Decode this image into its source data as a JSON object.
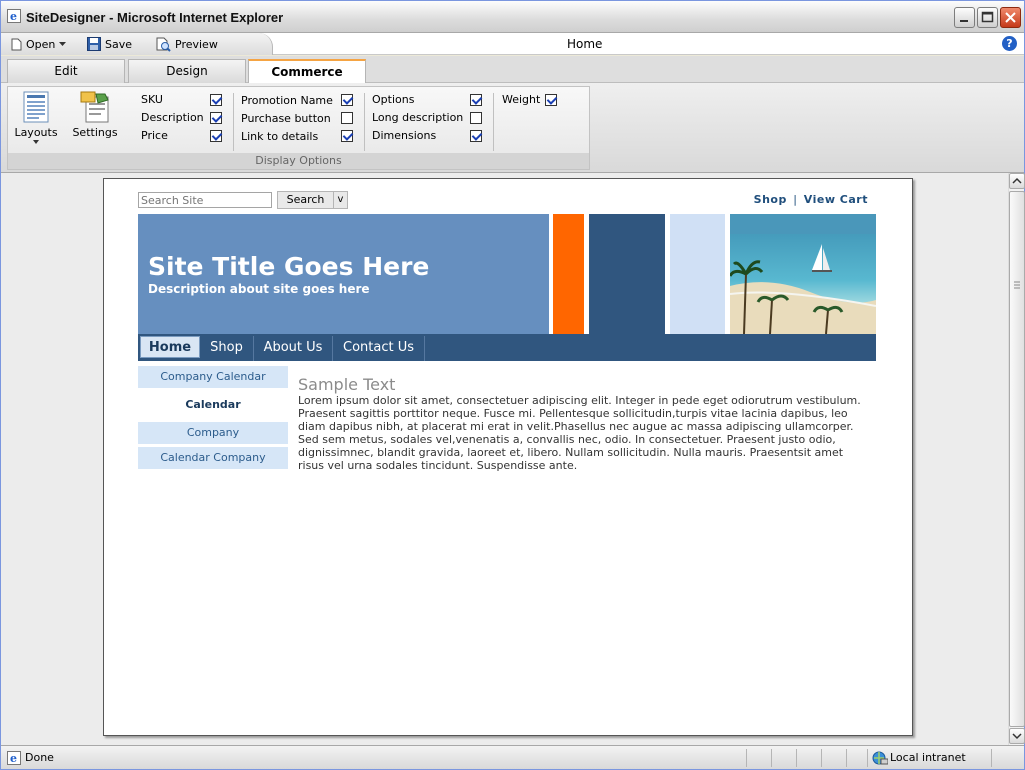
{
  "window": {
    "title": "SiteDesigner - Microsoft Internet Explorer"
  },
  "command_bar": {
    "open_label": "Open",
    "save_label": "Save",
    "preview_label": "Preview",
    "page_label": "Home"
  },
  "tabs": [
    {
      "label": "Edit",
      "active": false
    },
    {
      "label": "Design",
      "active": false
    },
    {
      "label": "Commerce",
      "active": true
    }
  ],
  "ribbon": {
    "layouts_label": "Layouts",
    "settings_label": "Settings",
    "group_label": "Display Options",
    "options": [
      {
        "label": "SKU",
        "checked": true
      },
      {
        "label": "Description",
        "checked": true
      },
      {
        "label": "Price",
        "checked": true
      },
      {
        "label": "Promotion Name",
        "checked": true
      },
      {
        "label": "Purchase button",
        "checked": false
      },
      {
        "label": "Link to details",
        "checked": true
      },
      {
        "label": "Options",
        "checked": true
      },
      {
        "label": "Long description",
        "checked": false
      },
      {
        "label": "Dimensions",
        "checked": true
      },
      {
        "label": "Weight",
        "checked": true
      }
    ]
  },
  "site": {
    "search_placeholder": "Search Site",
    "search_button": "Search",
    "search_dropdown": "v",
    "shop_link": "Shop",
    "link_separator": "|",
    "cart_link": "View Cart",
    "title": "Site Title Goes Here",
    "description": "Description about site goes here",
    "nav": [
      "Home",
      "Shop",
      "About Us",
      "Contact Us"
    ],
    "subnav": [
      "Company Calendar",
      "Calendar",
      "Company",
      "Calendar Company"
    ],
    "content_heading": "Sample Text",
    "content_body": "Lorem ipsum dolor sit amet, consectetuer adipiscing elit. Integer in pede eget odiorutrum vestibulum. Praesent sagittis porttitor neque. Fusce mi. Pellentesque sollicitudin,turpis vitae lacinia dapibus, leo diam dapibus nibh, at placerat mi erat in velit.Phasellus nec augue ac massa adipiscing ullamcorper. Sed sem metus, sodales vel,venenatis a, convallis nec, odio. In consectetuer. Praesent justo odio, dignissimnec, blandit gravida, laoreet et, libero. Nullam sollicitudin. Nulla mauris. Praesentsit amet risus vel urna sodales tincidunt. Suspendisse ante."
  },
  "colors": {
    "banner": "#668fbf",
    "accent_orange": "#ff6600",
    "nav_dark": "#30567f",
    "light_blue": "#d0e0f5",
    "tab_highlight": "#f5a443"
  },
  "status": {
    "left": "Done",
    "zone": "Local intranet"
  }
}
